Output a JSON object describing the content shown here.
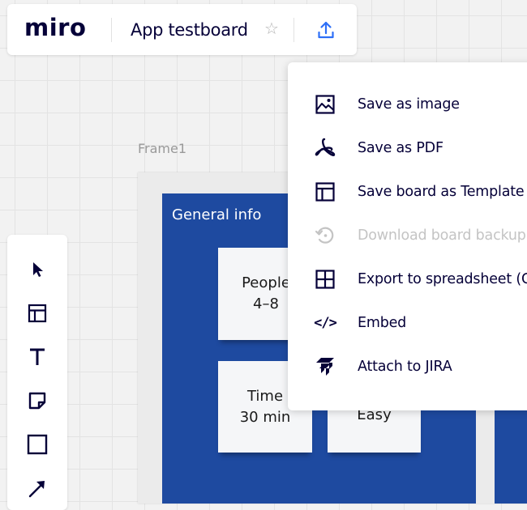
{
  "header": {
    "logo": "miro",
    "board_title": "App testboard",
    "star_icon": "star-icon",
    "export_icon": "upload-icon"
  },
  "canvas": {
    "frame_label": "Frame1",
    "section_title": "General info",
    "stickies": [
      {
        "line1": "People",
        "line2": "4–8"
      },
      {
        "line1": "Time",
        "line2": "30 min"
      },
      {
        "line1": "Easy",
        "line2": ""
      }
    ]
  },
  "toolbar": {
    "tools": [
      {
        "name": "select-tool",
        "icon": "cursor-icon"
      },
      {
        "name": "templates-tool",
        "icon": "template-icon"
      },
      {
        "name": "text-tool",
        "icon": "text-icon"
      },
      {
        "name": "sticky-note-tool",
        "icon": "sticky-note-icon"
      },
      {
        "name": "shape-tool",
        "icon": "square-icon"
      },
      {
        "name": "connection-line-tool",
        "icon": "arrow-icon"
      }
    ]
  },
  "export_menu": {
    "items": [
      {
        "label": "Save as image",
        "icon": "image-icon",
        "enabled": true
      },
      {
        "label": "Save as PDF",
        "icon": "pdf-icon",
        "enabled": true
      },
      {
        "label": "Save board as Template",
        "icon": "template-icon",
        "enabled": true
      },
      {
        "label": "Download board backup",
        "icon": "backup-icon",
        "enabled": false
      },
      {
        "label": "Export to spreadsheet (C",
        "icon": "spreadsheet-icon",
        "enabled": true
      },
      {
        "label": "Embed",
        "icon": "code-icon",
        "enabled": true
      },
      {
        "label": "Attach to JIRA",
        "icon": "jira-icon",
        "enabled": true
      }
    ]
  },
  "colors": {
    "brand_text": "#050038",
    "frame_blue": "#1e4aa0",
    "accent_blue": "#2d6ff7",
    "disabled": "#c4c4c4"
  }
}
